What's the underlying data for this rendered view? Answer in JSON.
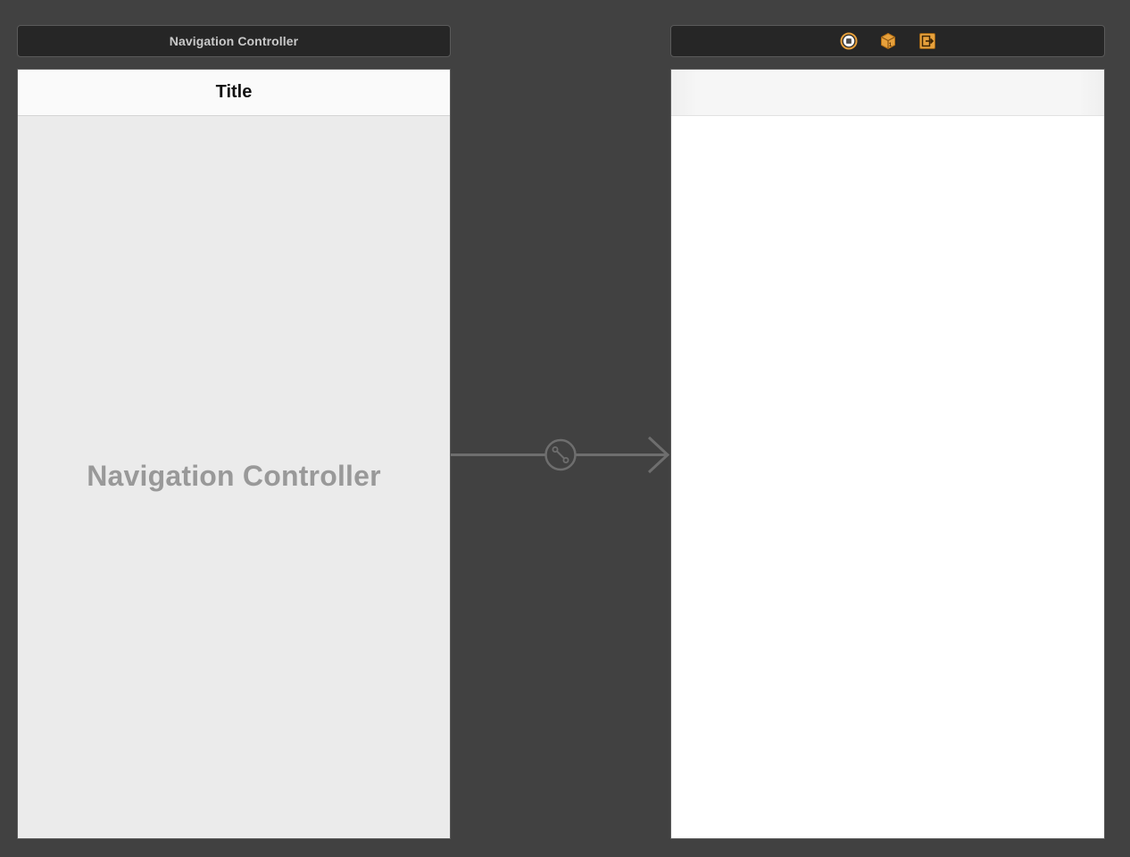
{
  "scenes": [
    {
      "bar_title": "Navigation Controller",
      "nav_title": "Title",
      "placeholder": "Navigation Controller"
    },
    {
      "bar_title": "",
      "nav_title": "",
      "dock_icons": [
        "view-controller-icon",
        "first-responder-icon",
        "exit-icon"
      ]
    }
  ],
  "segue": {
    "type": "relationship",
    "icon": "relationship-segue-icon"
  },
  "colors": {
    "canvas_background": "#414141",
    "scene_bar_background": "#262626",
    "scene_bar_text": "#c9c9c9",
    "dock_icon_accent": "#e7a13c",
    "nav_bar_background": "#fafafa",
    "placeholder_text": "#999999",
    "segue_line": "#6e6e6e"
  }
}
